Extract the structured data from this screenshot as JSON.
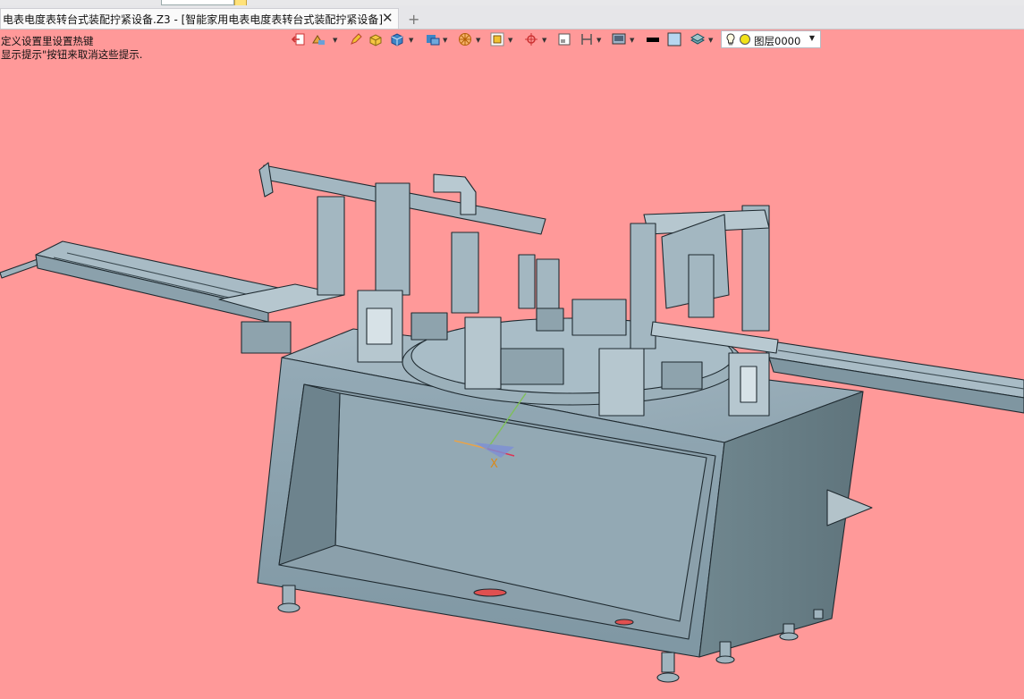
{
  "window": {
    "tab_title": "电表电度表转台式装配拧紧设备.Z3 - [智能家用电表电度表转台式装配拧紧设备]",
    "close_glyph": "✕",
    "add_tab_glyph": "+"
  },
  "hints": {
    "line1": "定义设置里设置热键",
    "line2": "显示提示\"按钮来取消这些提示."
  },
  "toolbar": {
    "layer_name": "图层0000",
    "layer_light": "bulb-icon",
    "layer_color": "#f2e218",
    "icons": [
      "exit-view-icon",
      "display-style-icon",
      "pencil-icon",
      "shaded-box-icon",
      "cube-icon",
      "view-orient-icon",
      "section-icon",
      "render-icon",
      "zoom-fit-icon",
      "pan-icon",
      "frame-icon",
      "measure-icon",
      "screen-icon",
      "line-color-icon",
      "fill-color-icon",
      "layers-icon"
    ]
  },
  "scene": {
    "background": "#ff9999",
    "model_color": "#8fa6b1",
    "triad_label": "X"
  }
}
